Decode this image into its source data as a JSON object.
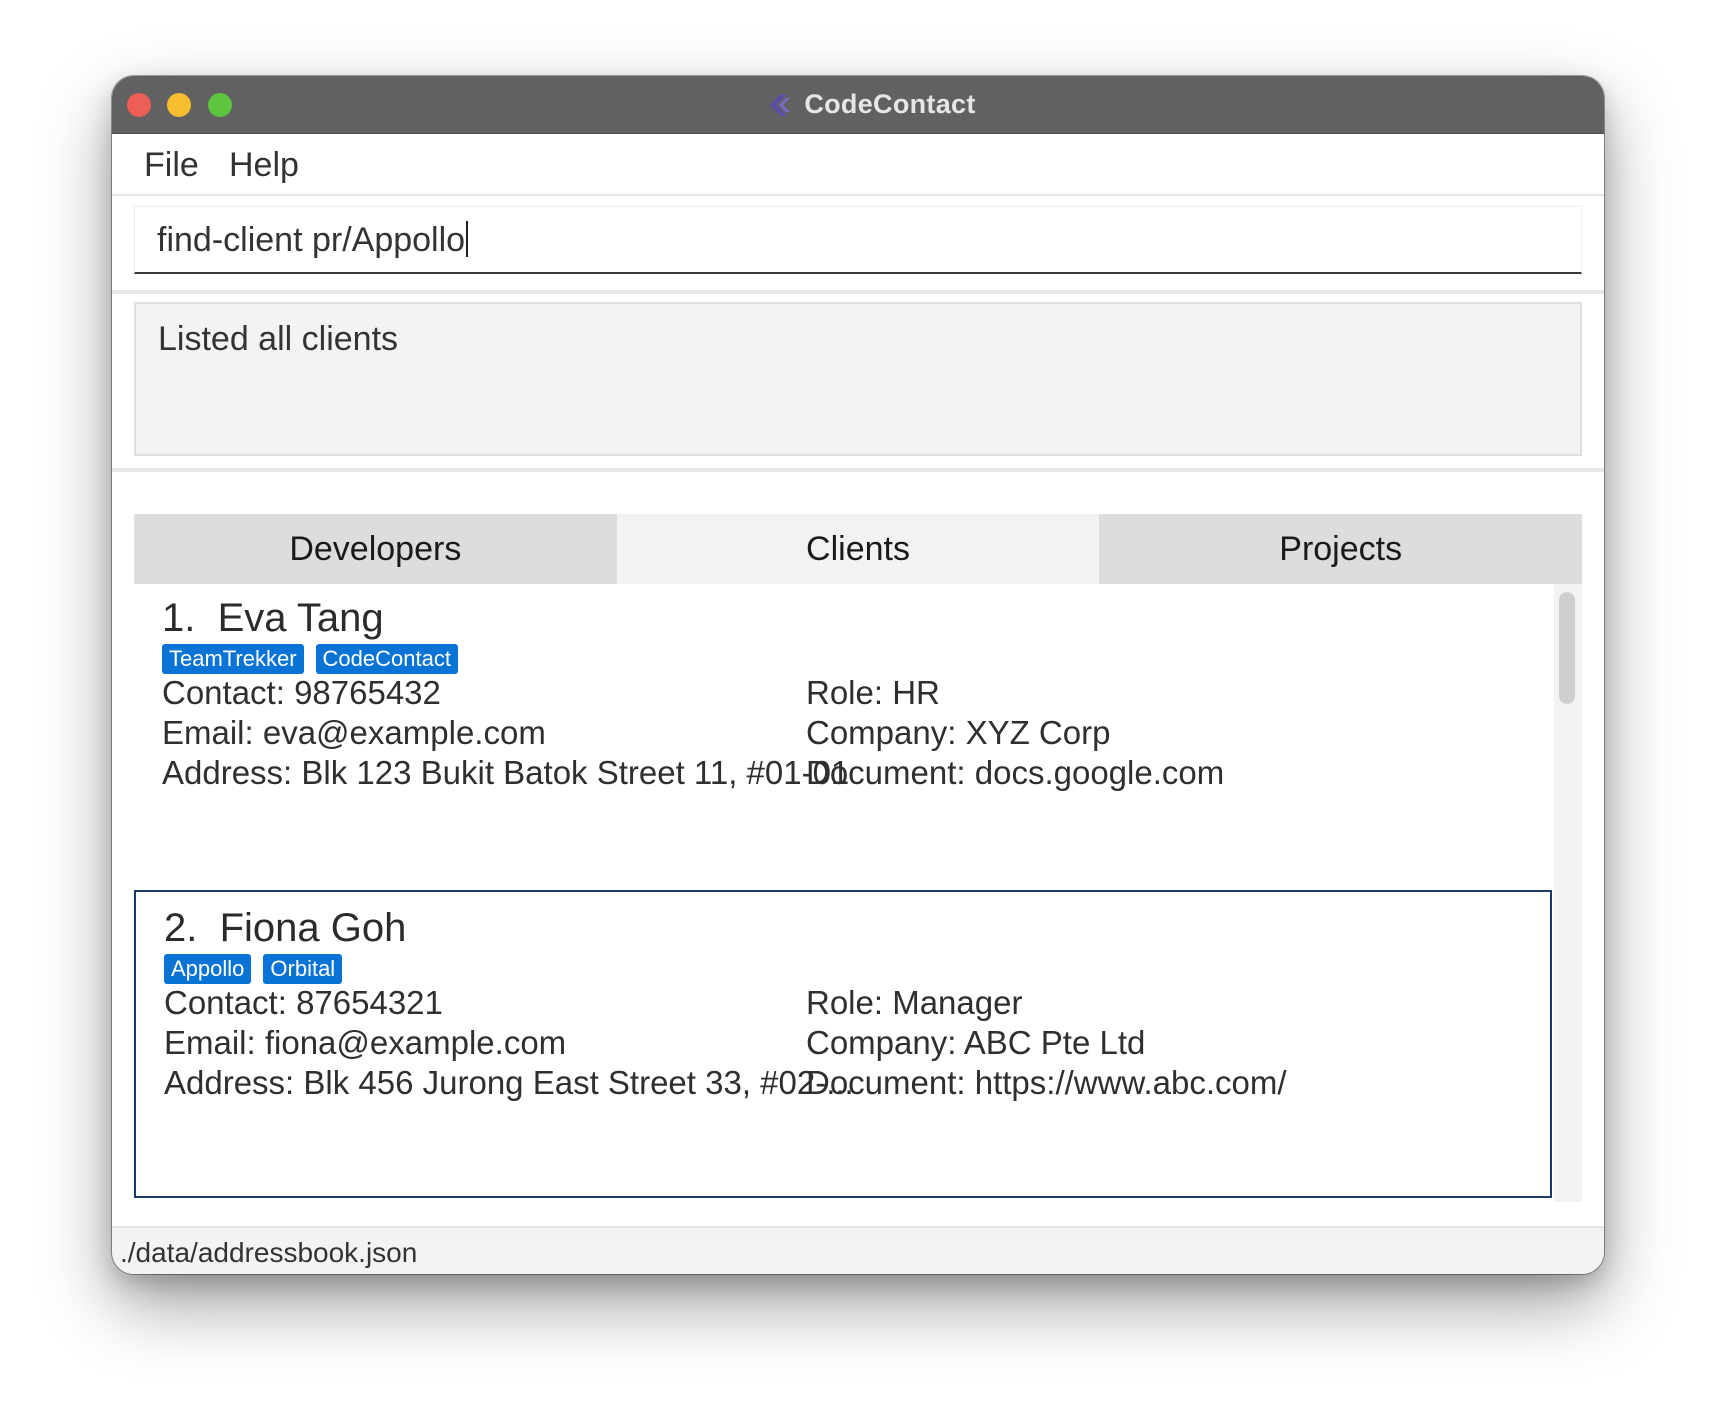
{
  "window": {
    "title": "CodeContact"
  },
  "menu": {
    "file": "File",
    "help": "Help"
  },
  "command": {
    "value": "find-client pr/Appollo"
  },
  "result": {
    "message": "Listed all clients"
  },
  "tabs": [
    {
      "label": "Developers",
      "active": false
    },
    {
      "label": "Clients",
      "active": true
    },
    {
      "label": "Projects",
      "active": false
    }
  ],
  "clients": [
    {
      "index": "1.",
      "name": "Eva Tang",
      "tags": [
        "TeamTrekker",
        "CodeContact"
      ],
      "contact": "Contact: 98765432",
      "email": "Email: eva@example.com",
      "address": "Address: Blk 123 Bukit Batok Street 11, #01-01",
      "role": "Role: HR",
      "company": "Company: XYZ Corp",
      "document": "Document: docs.google.com"
    },
    {
      "index": "2.",
      "name": "Fiona Goh",
      "tags": [
        "Appollo",
        "Orbital"
      ],
      "contact": "Contact: 87654321",
      "email": "Email: fiona@example.com",
      "address": "Address: Blk 456 Jurong East Street 33, #02-...",
      "role": "Role: Manager",
      "company": "Company: ABC Pte Ltd",
      "document": "Document: https://www.abc.com/"
    }
  ],
  "status": {
    "path": "./data/addressbook.json"
  },
  "colors": {
    "titlebar": "#616161",
    "tag": "#0a74d6",
    "selected_border": "#1a3a6e"
  }
}
